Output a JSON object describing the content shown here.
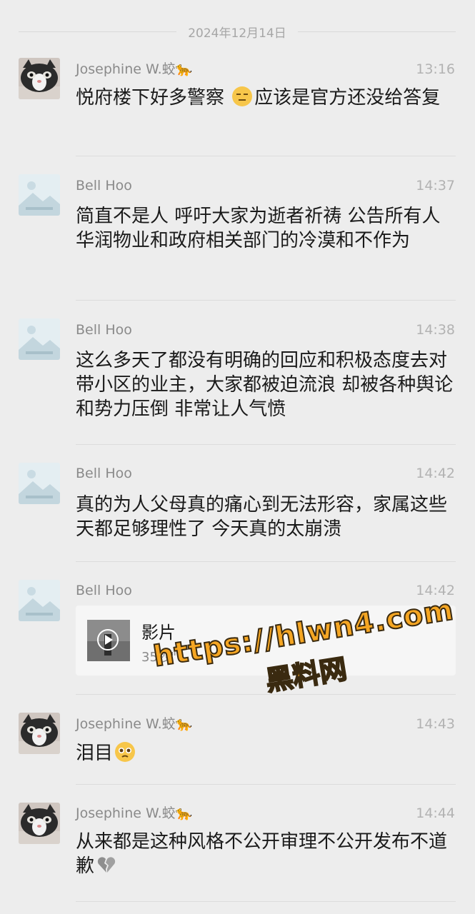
{
  "date_separator": "2024年12月14日",
  "messages": [
    {
      "name": "Josephine W.蛟",
      "name_icon": "leopard-icon",
      "time": "13:16",
      "avatar": "cat-avatar",
      "text_a": "悦府楼下好多警察 ",
      "emoji": "expressionless-face-icon",
      "text_b": "应该是官方还没给答复"
    },
    {
      "name": "Bell Hoo",
      "time": "14:37",
      "avatar": "placeholder-avatar",
      "text": "简直不是人 呼吁大家为逝者祈祷 公告所有人 华润物业和政府相关部门的冷漠和不作为"
    },
    {
      "name": "Bell Hoo",
      "time": "14:38",
      "avatar": "placeholder-avatar",
      "text": "这么多天了都没有明确的回应和积极态度去对带小区的业主，大家都被迫流浪 却被各种舆论和势力压倒 非常让人气愤"
    },
    {
      "name": "Bell Hoo",
      "time": "14:42",
      "avatar": "placeholder-avatar",
      "text": "真的为人父母真的痛心到无法形容，家属这些天都足够理性了 今天真的太崩溃"
    },
    {
      "name": "Bell Hoo",
      "time": "14:42",
      "avatar": "placeholder-avatar",
      "video": {
        "title": "影片",
        "duration": "35秒\""
      }
    },
    {
      "name": "Josephine W.蛟",
      "name_icon": "leopard-icon",
      "time": "14:43",
      "avatar": "cat-avatar",
      "text": "泪目",
      "emoji": "pleading-face-icon"
    },
    {
      "name": "Josephine W.蛟",
      "name_icon": "leopard-icon",
      "time": "14:44",
      "avatar": "cat-avatar",
      "text": "从来都是这种风格不公开审理不公开发布不道歉",
      "emoji": "broken-heart-icon"
    }
  ],
  "watermark": {
    "line1": "https://hlwn4.com",
    "line2": "黑料网"
  },
  "colors": {
    "background": "#ededed",
    "name": "#8a8a8a",
    "time": "#b2b2b2",
    "watermark": "#f5a623"
  }
}
